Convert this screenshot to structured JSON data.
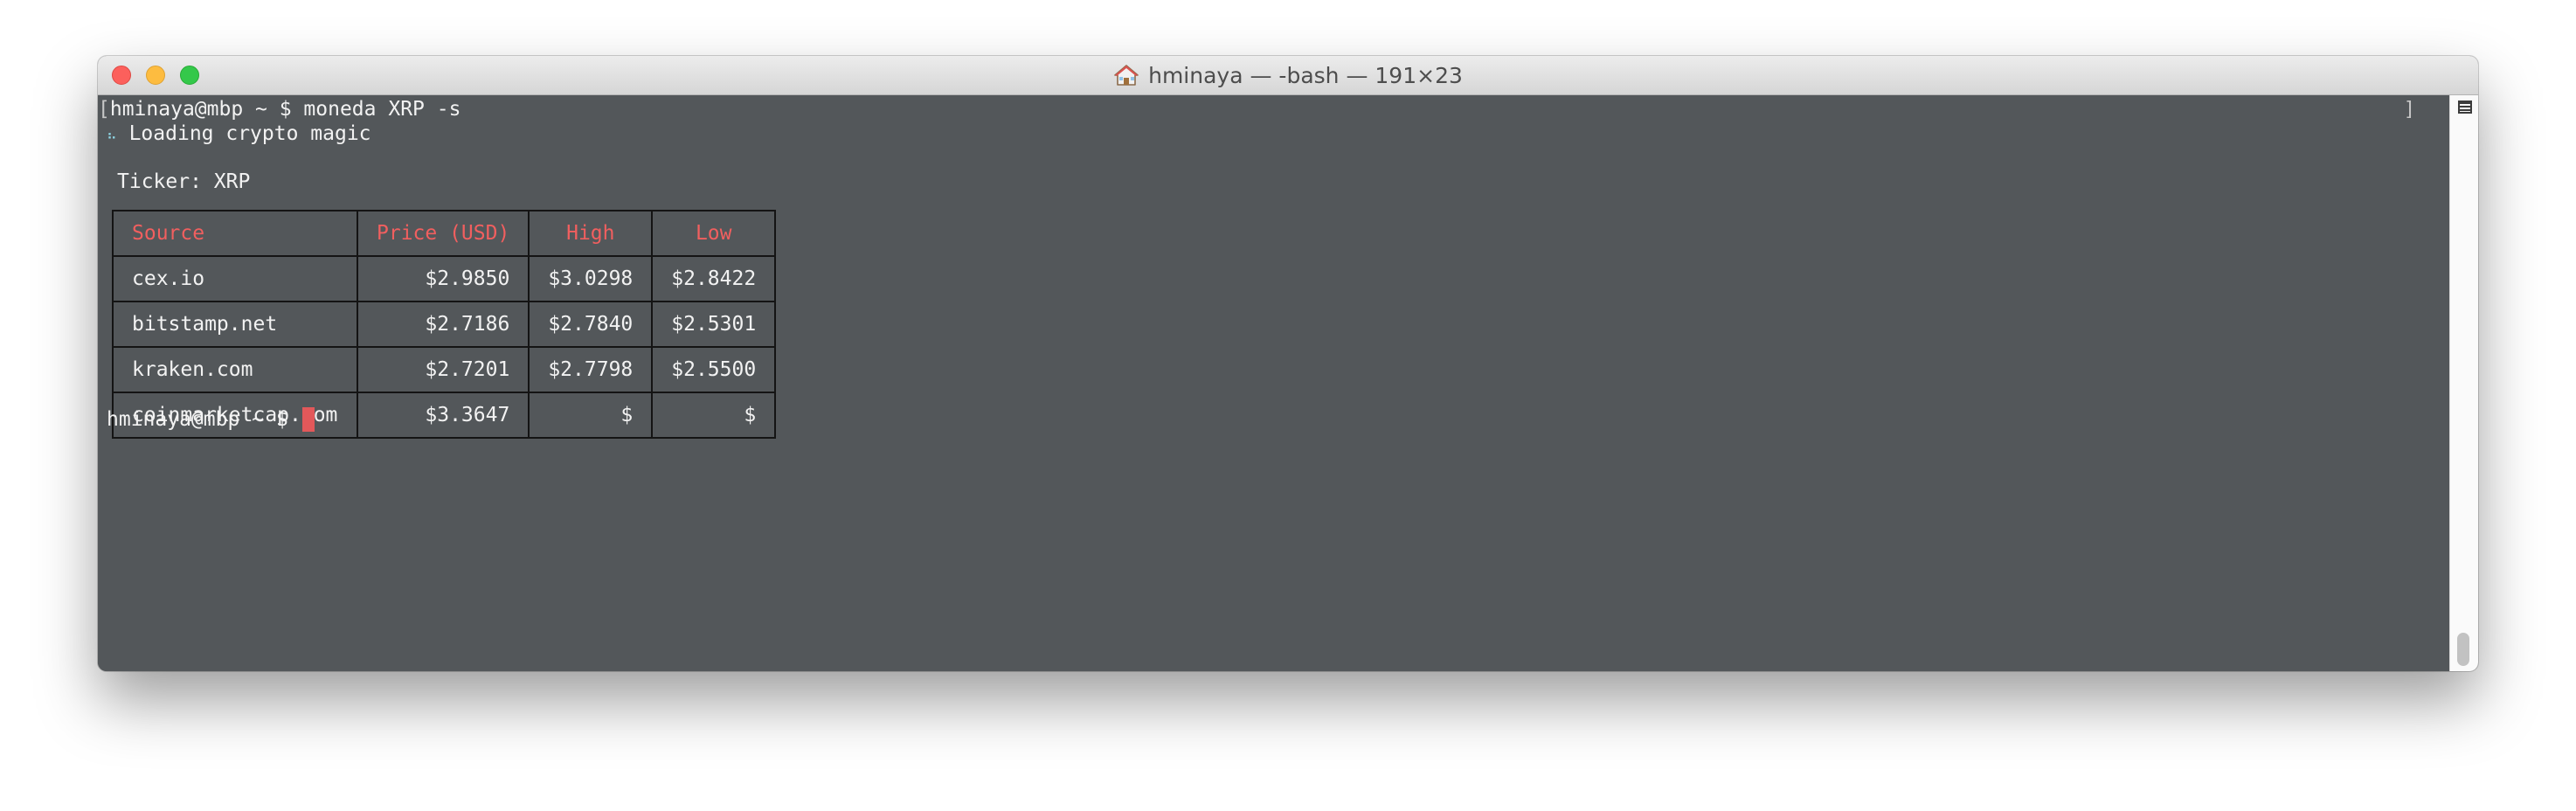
{
  "window": {
    "title": "hminaya — -bash — 191×23",
    "colors": {
      "terminal_background": "#53575a",
      "text": "#f2f2f2",
      "table_header": "#f15f5f",
      "cursor": "#e2585a",
      "close": "#fc605c",
      "minimize": "#fdbc40",
      "zoom": "#34c84a"
    }
  },
  "terminal": {
    "command_prompt": "hminaya@mbp ~ $ ",
    "command": "moneda XRP -s",
    "spinner_glyph": "⠦",
    "loading_text": "Loading crypto magic",
    "ticker_label": "Ticker: XRP",
    "final_prompt": "hminaya@mbp ~ $ ",
    "bracket_left": "[",
    "bracket_right": "]"
  },
  "table": {
    "headers": {
      "source": "Source",
      "price": "Price (USD)",
      "high": "High",
      "low": "Low"
    },
    "rows": [
      {
        "source": "cex.io",
        "price": "$2.9850",
        "high": "$3.0298",
        "low": "$2.8422"
      },
      {
        "source": "bitstamp.net",
        "price": "$2.7186",
        "high": "$2.7840",
        "low": "$2.5301"
      },
      {
        "source": "kraken.com",
        "price": "$2.7201",
        "high": "$2.7798",
        "low": "$2.5500"
      },
      {
        "source": "coinmarketcap.com",
        "price": "$3.3647",
        "high": "$",
        "low": "$"
      }
    ]
  },
  "icons": {
    "title_icon": "home-icon",
    "scroll_marker": "mark-list-icon"
  }
}
